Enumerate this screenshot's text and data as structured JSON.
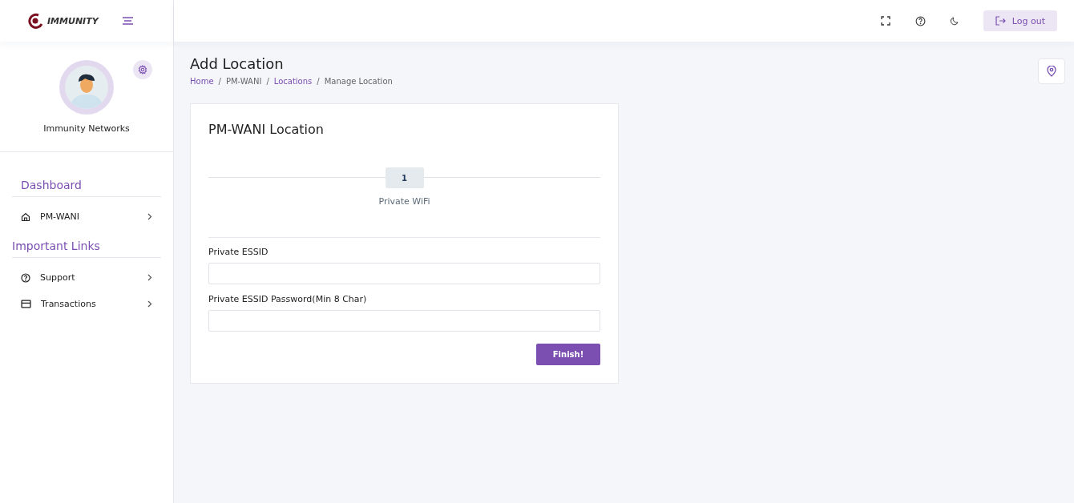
{
  "logo": {
    "text": "IMMUNITY"
  },
  "profile": {
    "name": "Immunity Networks"
  },
  "sidebar": {
    "sections": [
      {
        "title": "Dashboard",
        "items": [
          {
            "label": "PM-WANI"
          }
        ]
      },
      {
        "title": "Important Links",
        "items": [
          {
            "label": "Support"
          },
          {
            "label": "Transactions"
          }
        ]
      }
    ]
  },
  "topbar": {
    "logout": "Log out"
  },
  "page": {
    "title": "Add Location",
    "breadcrumb_separator": "/",
    "breadcrumb": [
      {
        "label": "Home",
        "link": true
      },
      {
        "label": "PM-WANI",
        "link": false
      },
      {
        "label": "Locations",
        "link": true
      },
      {
        "label": "Manage Location",
        "link": false
      }
    ]
  },
  "card": {
    "title": "PM-WANI Location",
    "steps": [
      {
        "number": "1",
        "label": "Private WiFi"
      }
    ],
    "fields": [
      {
        "label": "Private ESSID"
      },
      {
        "label": "Private ESSID Password(Min 8 Char)"
      }
    ],
    "submit": "Finish!"
  }
}
